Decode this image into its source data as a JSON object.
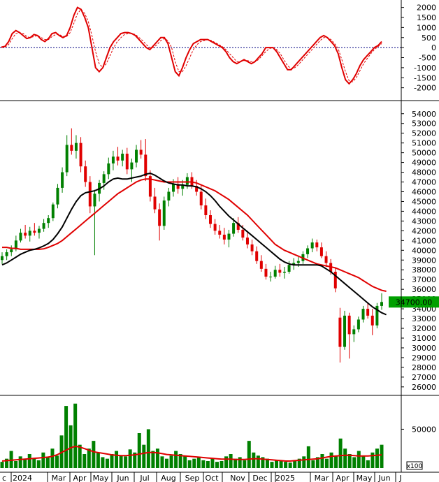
{
  "chart_data": [
    {
      "type": "line",
      "panel": "oscillator",
      "ylim": [
        -2500,
        2300
      ],
      "yticks": [
        "2000",
        "1500",
        "1000",
        "500",
        "0",
        "-500",
        "-1000",
        "-1500",
        "-2000"
      ],
      "zero_line": true,
      "colors": {
        "main": "#e00000",
        "signal": "#e00000",
        "zero": "#000080"
      },
      "series": [
        {
          "style": "solid",
          "values": [
            20,
            60,
            300,
            700,
            850,
            750,
            600,
            450,
            500,
            650,
            600,
            400,
            300,
            450,
            700,
            750,
            600,
            500,
            600,
            1000,
            1600,
            2000,
            1900,
            1500,
            1000,
            0,
            -1000,
            -1200,
            -1000,
            -500,
            0,
            300,
            500,
            700,
            750,
            750,
            700,
            600,
            400,
            200,
            0,
            -100,
            100,
            300,
            500,
            500,
            200,
            -500,
            -1200,
            -1400,
            -1000,
            -500,
            -100,
            200,
            300,
            400,
            400,
            400,
            300,
            200,
            100,
            0,
            -200,
            -500,
            -700,
            -800,
            -700,
            -600,
            -700,
            -800,
            -700,
            -500,
            -300,
            0,
            0,
            0,
            -200,
            -500,
            -800,
            -1100,
            -1100,
            -900,
            -700,
            -500,
            -300,
            -100,
            100,
            300,
            500,
            600,
            500,
            300,
            100,
            -300,
            -1000,
            -1600,
            -1800,
            -1600,
            -1300,
            -900,
            -600,
            -400,
            -200,
            0,
            100,
            300
          ]
        },
        {
          "style": "dashed",
          "values": [
            0,
            30,
            150,
            450,
            700,
            750,
            700,
            550,
            500,
            550,
            600,
            500,
            400,
            400,
            550,
            650,
            650,
            550,
            550,
            750,
            1200,
            1700,
            1900,
            1700,
            1300,
            600,
            -200,
            -800,
            -1000,
            -800,
            -400,
            0,
            300,
            500,
            650,
            700,
            700,
            650,
            500,
            350,
            150,
            0,
            0,
            150,
            350,
            450,
            350,
            0,
            -700,
            -1200,
            -1200,
            -900,
            -500,
            -100,
            150,
            300,
            350,
            400,
            350,
            250,
            150,
            50,
            -100,
            -300,
            -500,
            -700,
            -700,
            -650,
            -650,
            -700,
            -700,
            -600,
            -400,
            -200,
            -50,
            0,
            -100,
            -300,
            -600,
            -900,
            -1050,
            -1000,
            -850,
            -650,
            -450,
            -250,
            -50,
            150,
            350,
            500,
            500,
            400,
            200,
            -50,
            -600,
            -1200,
            -1650,
            -1700,
            -1500,
            -1150,
            -800,
            -550,
            -300,
            -100,
            50,
            200
          ]
        }
      ]
    },
    {
      "type": "candlestick",
      "panel": "price",
      "ylim": [
        25200,
        55200
      ],
      "yticks": [
        "54000",
        "53000",
        "52000",
        "51000",
        "50000",
        "49000",
        "48000",
        "47000",
        "46000",
        "45000",
        "44000",
        "43000",
        "42000",
        "41000",
        "40000",
        "39000",
        "38000",
        "37000",
        "36000",
        "35000",
        "34000",
        "33000",
        "32000",
        "31000",
        "30000",
        "29000",
        "28000",
        "27000",
        "26000"
      ],
      "last_price_label": "34700.00",
      "colors": {
        "up": "#008000",
        "down": "#e00000",
        "ma_fast": "#000000",
        "ma_slow": "#e00000",
        "last_price_bg": "#00a000"
      },
      "ohlc": [
        [
          39000,
          39800,
          38600,
          39400
        ],
        [
          39400,
          40100,
          39000,
          39800
        ],
        [
          39800,
          40500,
          39400,
          40100
        ],
        [
          40100,
          41500,
          39900,
          41000
        ],
        [
          41000,
          42200,
          40800,
          41800
        ],
        [
          41800,
          42600,
          41200,
          41500
        ],
        [
          41500,
          42400,
          40900,
          42000
        ],
        [
          42000,
          42800,
          41500,
          41800
        ],
        [
          41800,
          42500,
          41200,
          42200
        ],
        [
          42200,
          43200,
          41900,
          42800
        ],
        [
          42800,
          43600,
          42300,
          43300
        ],
        [
          43300,
          44900,
          43000,
          44700
        ],
        [
          44700,
          46800,
          44300,
          46400
        ],
        [
          46400,
          48500,
          45900,
          48000
        ],
        [
          48000,
          51800,
          47600,
          50800
        ],
        [
          50800,
          52500,
          49800,
          50200
        ],
        [
          50200,
          51800,
          49400,
          51000
        ],
        [
          51000,
          51600,
          48000,
          48600
        ],
        [
          48600,
          49200,
          46500,
          47000
        ],
        [
          47000,
          47600,
          43800,
          44500
        ],
        [
          44500,
          46200,
          39500,
          45800
        ],
        [
          45800,
          47200,
          45000,
          46900
        ],
        [
          46900,
          48100,
          46200,
          47800
        ],
        [
          47800,
          49500,
          47300,
          48900
        ],
        [
          48900,
          50200,
          48200,
          49600
        ],
        [
          49600,
          50600,
          48700,
          49200
        ],
        [
          49200,
          50300,
          48600,
          49900
        ],
        [
          49900,
          50500,
          47800,
          48300
        ],
        [
          48300,
          49400,
          47000,
          49000
        ],
        [
          49000,
          50800,
          48500,
          50300
        ],
        [
          50300,
          51300,
          49400,
          49800
        ],
        [
          49800,
          51400,
          47100,
          47600
        ],
        [
          47600,
          48200,
          45000,
          45500
        ],
        [
          45500,
          46400,
          43800,
          44200
        ],
        [
          44200,
          44800,
          41000,
          42500
        ],
        [
          42500,
          45500,
          42100,
          45100
        ],
        [
          45100,
          46400,
          44500,
          46000
        ],
        [
          46000,
          47300,
          45500,
          46800
        ],
        [
          46800,
          47500,
          45800,
          46300
        ],
        [
          46300,
          47200,
          45600,
          46700
        ],
        [
          46700,
          47900,
          46300,
          47500
        ],
        [
          47500,
          48000,
          46300,
          46600
        ],
        [
          46600,
          47200,
          45600,
          46000
        ],
        [
          46000,
          46600,
          44200,
          44600
        ],
        [
          44600,
          45300,
          43200,
          43600
        ],
        [
          43600,
          44100,
          42300,
          42700
        ],
        [
          42700,
          43200,
          41600,
          42000
        ],
        [
          42000,
          42600,
          41200,
          41600
        ],
        [
          41600,
          42300,
          40600,
          41100
        ],
        [
          41100,
          42100,
          40300,
          41700
        ],
        [
          41700,
          43300,
          41400,
          42800
        ],
        [
          42800,
          43400,
          41800,
          42100
        ],
        [
          42100,
          42600,
          41000,
          41300
        ],
        [
          41300,
          41800,
          40200,
          40600
        ],
        [
          40600,
          41100,
          39500,
          39900
        ],
        [
          39900,
          40400,
          38600,
          38900
        ],
        [
          38900,
          39500,
          37800,
          38100
        ],
        [
          38100,
          38600,
          37000,
          37300
        ],
        [
          37300,
          37800,
          36800,
          37300
        ],
        [
          37300,
          38400,
          37100,
          38000
        ],
        [
          38000,
          38600,
          37300,
          37700
        ],
        [
          37700,
          38300,
          37100,
          37800
        ],
        [
          37800,
          38900,
          37600,
          38500
        ],
        [
          38500,
          39200,
          38000,
          38700
        ],
        [
          38700,
          39300,
          38300,
          38900
        ],
        [
          38900,
          39900,
          38600,
          39600
        ],
        [
          39600,
          40500,
          39200,
          40200
        ],
        [
          40200,
          41200,
          39800,
          40800
        ],
        [
          40800,
          41100,
          39900,
          40300
        ],
        [
          40300,
          40800,
          39200,
          39400
        ],
        [
          39400,
          39900,
          38300,
          38700
        ],
        [
          38700,
          39100,
          37500,
          37800
        ],
        [
          37800,
          38200,
          35700,
          36100
        ],
        [
          33100,
          34100,
          28500,
          30100
        ],
        [
          30100,
          33800,
          29800,
          33300
        ],
        [
          33300,
          33600,
          28900,
          31400
        ],
        [
          31400,
          32300,
          30600,
          31900
        ],
        [
          31900,
          33200,
          31600,
          32900
        ],
        [
          32900,
          34300,
          32600,
          34000
        ],
        [
          34000,
          34600,
          33000,
          33300
        ],
        [
          33300,
          34000,
          31300,
          32300
        ],
        [
          32300,
          34600,
          32000,
          34300
        ],
        [
          34300,
          35600,
          33900,
          34700
        ]
      ],
      "ma_fast": [
        38500,
        38700,
        39000,
        39300,
        39600,
        39800,
        40000,
        40100,
        40250,
        40450,
        40700,
        41100,
        41700,
        42400,
        43300,
        44200,
        45000,
        45600,
        45900,
        46000,
        46100,
        46300,
        46600,
        47000,
        47300,
        47400,
        47300,
        47300,
        47400,
        47500,
        47600,
        47800,
        47900,
        47700,
        47400,
        47100,
        46900,
        46800,
        46700,
        46700,
        46600,
        46600,
        46500,
        46300,
        46000,
        45600,
        45100,
        44500,
        44000,
        43500,
        43100,
        42700,
        42300,
        41900,
        41500,
        41100,
        40700,
        40300,
        39900,
        39500,
        39100,
        38800,
        38600,
        38500,
        38500,
        38500,
        38500,
        38500,
        38500,
        38400,
        38100,
        37800,
        37400,
        37000,
        36600,
        36200,
        35800,
        35400,
        35000,
        34600,
        34200,
        33900,
        33600,
        33400
      ],
      "ma_slow": [
        40300,
        40300,
        40200,
        40200,
        40100,
        40100,
        40100,
        40100,
        40100,
        40150,
        40300,
        40500,
        40700,
        41000,
        41400,
        41800,
        42200,
        42600,
        43000,
        43400,
        43800,
        44200,
        44600,
        45000,
        45400,
        45800,
        46100,
        46400,
        46700,
        47000,
        47200,
        47300,
        47300,
        47200,
        47100,
        47000,
        47000,
        47000,
        47000,
        47000,
        47000,
        47000,
        46900,
        46700,
        46500,
        46300,
        46100,
        45800,
        45500,
        45200,
        44800,
        44400,
        44000,
        43600,
        43100,
        42600,
        42100,
        41600,
        41100,
        40600,
        40300,
        40000,
        39800,
        39600,
        39400,
        39200,
        39000,
        38800,
        38600,
        38500,
        38400,
        38300,
        38200,
        38000,
        37800,
        37600,
        37400,
        37200,
        36900,
        36600,
        36300,
        36100,
        35900,
        35800
      ]
    },
    {
      "type": "bar",
      "panel": "volume",
      "ylim": [
        0,
        90000
      ],
      "yticks": [
        "50000"
      ],
      "unit_label": "x100",
      "colors": {
        "bars": "#008000",
        "ma": "#e00000"
      },
      "values": [
        8000,
        12000,
        22000,
        9000,
        15000,
        11000,
        18000,
        13000,
        10000,
        20000,
        14000,
        25000,
        16000,
        42000,
        80000,
        55000,
        83000,
        30000,
        18000,
        25000,
        35000,
        20000,
        14000,
        12000,
        18000,
        22000,
        16000,
        15000,
        24000,
        20000,
        45000,
        30000,
        50000,
        22000,
        25000,
        15000,
        12000,
        16000,
        22000,
        18000,
        15000,
        10000,
        12000,
        14000,
        10000,
        9000,
        12000,
        8000,
        9000,
        15000,
        18000,
        12000,
        14000,
        10000,
        35000,
        20000,
        16000,
        14000,
        12000,
        8000,
        10000,
        9000,
        8000,
        7000,
        10000,
        12000,
        15000,
        28000,
        10000,
        14000,
        18000,
        12000,
        20000,
        15000,
        38000,
        25000,
        18000,
        14000,
        22000,
        15000,
        10000,
        20000,
        25000,
        30000
      ],
      "ma": [
        9000,
        9500,
        10000,
        10500,
        11000,
        11500,
        12000,
        12500,
        13000,
        13500,
        14000,
        15000,
        17000,
        20000,
        23000,
        26000,
        28000,
        27000,
        25000,
        23000,
        21000,
        20000,
        19000,
        18000,
        17000,
        16500,
        16000,
        16000,
        16500,
        17000,
        18000,
        19000,
        20000,
        20000,
        19500,
        18500,
        17500,
        17000,
        16500,
        16000,
        15500,
        15000,
        14500,
        14000,
        13500,
        13000,
        12500,
        12000,
        11500,
        11500,
        11500,
        11000,
        11000,
        11000,
        11500,
        12000,
        12000,
        11500,
        11000,
        10500,
        10000,
        9500,
        9000,
        9000,
        9500,
        10000,
        10500,
        11000,
        11500,
        12000,
        13000,
        14000,
        15000,
        15500,
        16000,
        16500,
        16500,
        16000,
        15500,
        15500,
        15500,
        16000,
        16500,
        17000
      ]
    }
  ],
  "x_axis": {
    "labels": [
      "c",
      "2024",
      "Mar",
      "Apr",
      "May",
      "Jun",
      "Jul",
      "Aug",
      "Sep",
      "Oct",
      "Nov",
      "Dec",
      "2025",
      "Mar",
      "Apr",
      "May",
      "Jun",
      "J"
    ]
  }
}
